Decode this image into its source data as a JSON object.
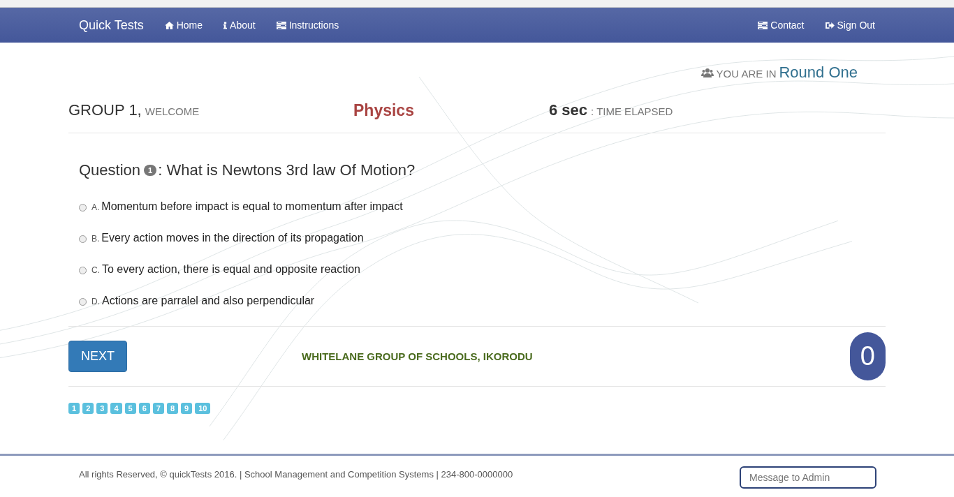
{
  "navbar": {
    "brand": "Quick Tests",
    "left_links": [
      {
        "label": "Home",
        "kind": "home"
      },
      {
        "label": "About",
        "kind": "info"
      },
      {
        "label": "Instructions",
        "kind": "list"
      }
    ],
    "right_links": [
      {
        "label": "Contact",
        "kind": "list"
      },
      {
        "label": "Sign Out",
        "kind": "signout"
      }
    ]
  },
  "round": {
    "prefix": "YOU ARE IN",
    "name": "Round One"
  },
  "header": {
    "group": "GROUP 1,",
    "welcome": "WELCOME",
    "subject": "Physics",
    "time": "6 sec",
    "time_label": ": TIME ELAPSED"
  },
  "question": {
    "prefix": "Question",
    "number": "1",
    "text": ": What is Newtons 3rd law Of Motion?"
  },
  "options": [
    {
      "letter": "A.",
      "text": "Momentum before impact is equal to momentum after impact",
      "selected": false
    },
    {
      "letter": "B.",
      "text": "Every action moves in the direction of its propagation",
      "selected": false
    },
    {
      "letter": "C.",
      "text": "To every action, there is equal and opposite reaction",
      "selected": false
    },
    {
      "letter": "D.",
      "text": "Actions are parralel and also perpendicular",
      "selected": false
    }
  ],
  "next_button": "NEXT",
  "school": "WHITELANE GROUP OF SCHOOLS, IKORODU",
  "score": "0",
  "pages": [
    "1",
    "2",
    "3",
    "4",
    "5",
    "6",
    "7",
    "8",
    "9",
    "10"
  ],
  "footer": {
    "text": "All rights Reserved, © quickTests 2016. | School Management and Competition Systems | 234-800-0000000",
    "message_placeholder": "Message to Admin"
  }
}
